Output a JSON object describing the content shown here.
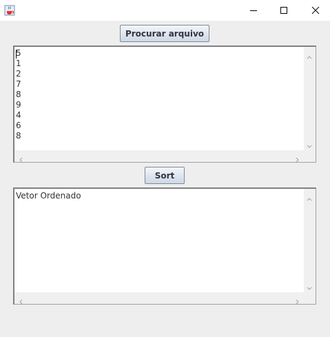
{
  "window": {
    "minimize_icon": "minimize-icon",
    "maximize_icon": "maximize-icon",
    "close_icon": "close-icon",
    "app_icon": "java-cup-icon"
  },
  "buttons": {
    "browse_label": "Procurar arquivo",
    "sort_label": "Sort"
  },
  "input_area": {
    "lines": [
      "5",
      "1",
      "2",
      "7",
      "8",
      "9",
      "4",
      "6",
      "8"
    ]
  },
  "output_area": {
    "text": "Vetor Ordenado"
  },
  "colors": {
    "background": "#eeeeee",
    "button_border": "#7a8a99"
  }
}
